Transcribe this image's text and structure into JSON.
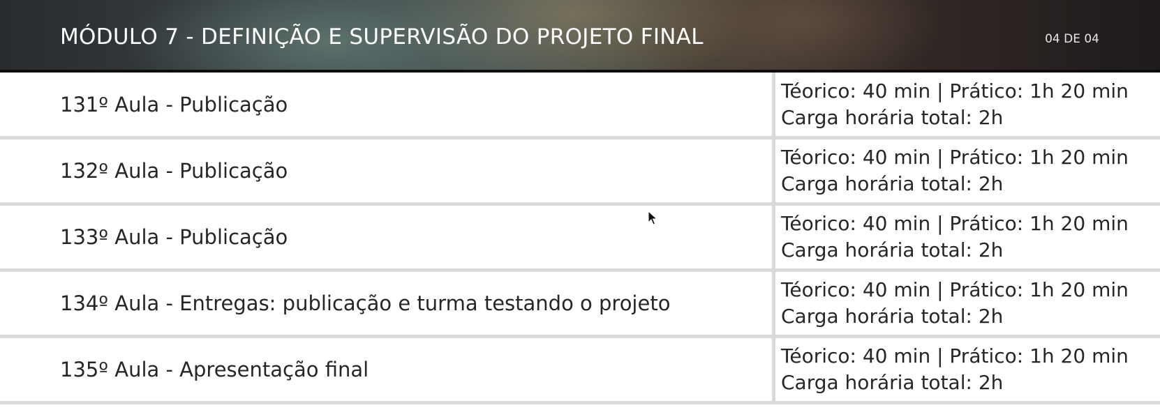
{
  "header": {
    "title": "MÓDULO 7 - DEFINIÇÃO E SUPERVISÃO DO PROJETO FINAL",
    "page_indicator": "04 DE 04"
  },
  "lessons": [
    {
      "title": "131º Aula - Publicação",
      "hours_line1": "Téorico: 40 min | Prático: 1h 20 min",
      "hours_line2": "Carga horária total: 2h"
    },
    {
      "title": "132º Aula - Publicação",
      "hours_line1": "Téorico: 40 min | Prático: 1h 20 min",
      "hours_line2": "Carga horária total: 2h"
    },
    {
      "title": "133º Aula - Publicação",
      "hours_line1": "Téorico: 40 min | Prático: 1h 20 min",
      "hours_line2": "Carga horária total: 2h"
    },
    {
      "title": "134º Aula - Entregas: publicação e turma testando o projeto",
      "hours_line1": "Téorico: 40 min | Prático: 1h 20 min",
      "hours_line2": "Carga horária total: 2h"
    },
    {
      "title": "135º Aula - Apresentação final",
      "hours_line1": "Téorico: 40 min | Prático: 1h 20 min",
      "hours_line2": "Carga horária total: 2h"
    }
  ],
  "colors": {
    "row_border": "#d9d9d9",
    "header_text": "#ffffff",
    "body_text": "#262626"
  }
}
